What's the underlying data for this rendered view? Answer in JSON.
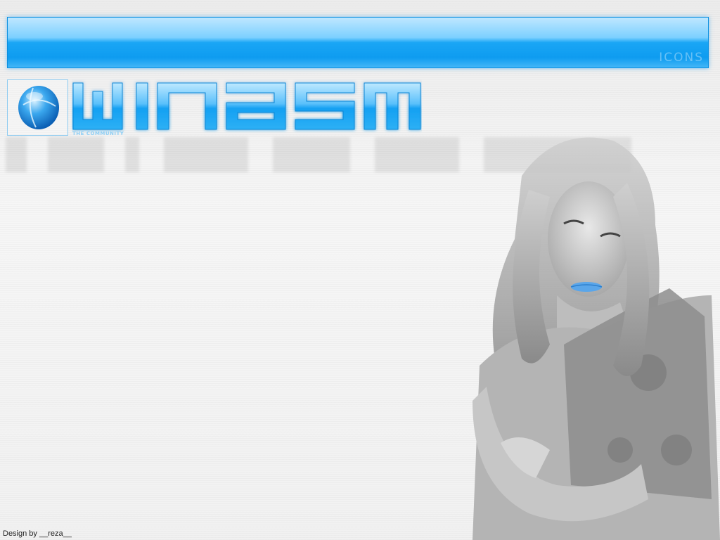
{
  "header": {
    "bar_label": "ICONS"
  },
  "logo": {
    "globe_icon": "globe-icon",
    "wordmark": "WINASM",
    "tagline": "THE COMMUNITY"
  },
  "portrait": {
    "subject": "portrait-photo"
  },
  "footer": {
    "credit": "Design by __reza__"
  },
  "colors": {
    "accent": "#1aa6f5",
    "accent_light": "#7cd0ff",
    "background": "#f1f1f1"
  }
}
